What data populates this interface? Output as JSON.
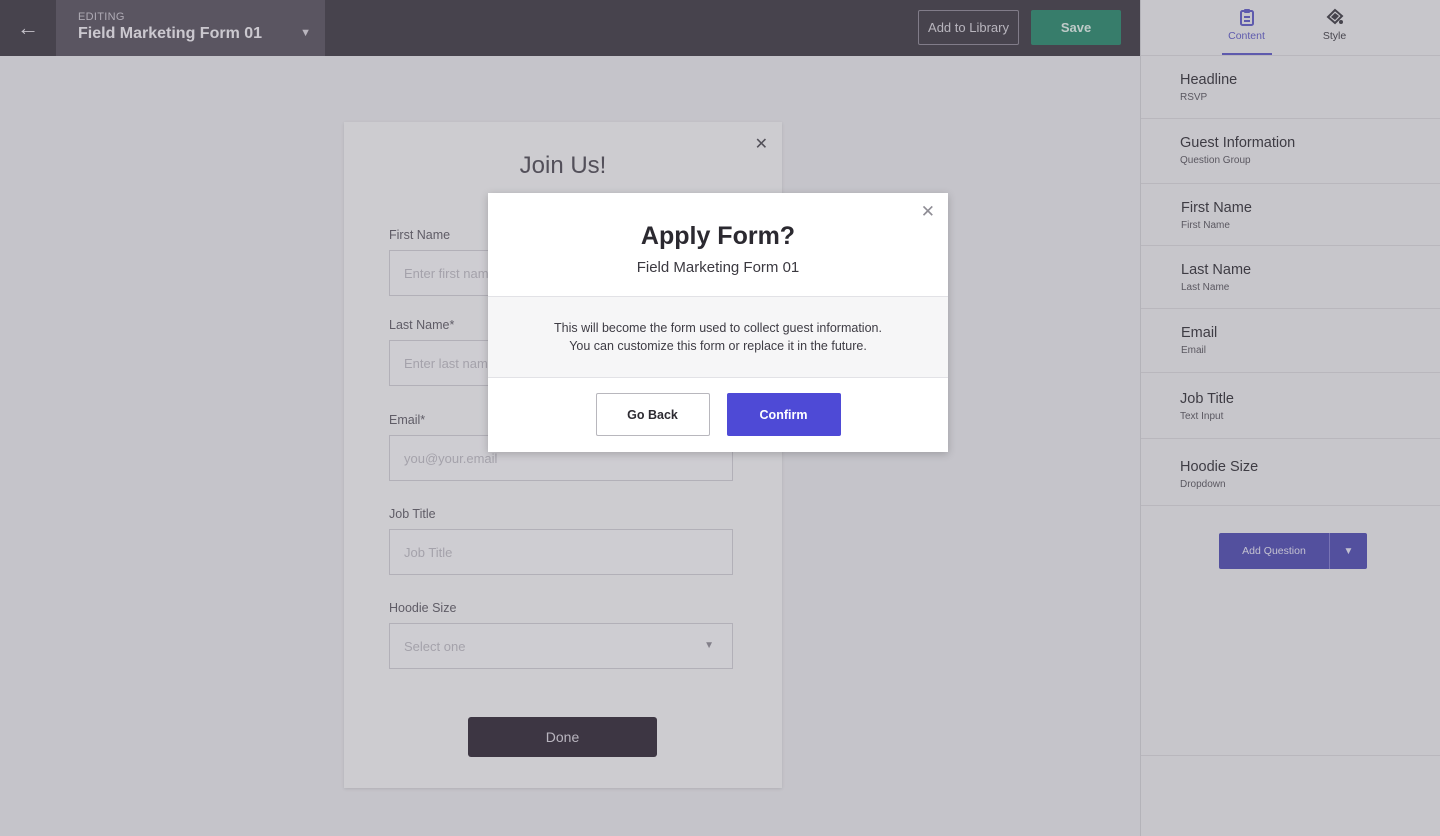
{
  "topbar": {
    "back_icon": "arrow-left-icon",
    "editing_label": "EDITING",
    "form_name": "Field Marketing Form 01",
    "add_to_library": "Add to Library",
    "save": "Save",
    "save_color": "#25876a"
  },
  "panel": {
    "tabs": [
      {
        "label": "Content",
        "icon": "clipboard-icon",
        "active": true
      },
      {
        "label": "Style",
        "icon": "paint-bucket-icon",
        "active": false
      }
    ],
    "questions": [
      {
        "title": "Headline",
        "sub": "RSVP"
      },
      {
        "title": "Guest Information",
        "sub": "Question Group"
      },
      {
        "title": "First Name",
        "sub": "First Name"
      },
      {
        "title": "Last Name",
        "sub": "Last Name"
      },
      {
        "title": "Email",
        "sub": "Email"
      },
      {
        "title": "Job Title",
        "sub": "Text Input"
      },
      {
        "title": "Hoodie Size",
        "sub": "Dropdown"
      }
    ],
    "add_question": "Add Question",
    "accent": "#4b48b0"
  },
  "form_preview": {
    "title": "Join Us!",
    "fields": [
      {
        "label": "First Name",
        "placeholder": "Enter first name"
      },
      {
        "label": "Last Name*",
        "placeholder": "Enter last name"
      },
      {
        "label": "Email*",
        "placeholder": "you@your.email"
      },
      {
        "label": "Job Title",
        "placeholder": "Job Title"
      },
      {
        "label": "Hoodie Size",
        "placeholder": "Select one"
      }
    ],
    "done": "Done"
  },
  "modal": {
    "title": "Apply Form?",
    "subtitle": "Field Marketing Form 01",
    "body_line1": "This will become the form used to collect guest information.",
    "body_line2": "You can customize this form or replace it in the future.",
    "go_back": "Go Back",
    "confirm": "Confirm",
    "confirm_color": "#4e4ad6"
  }
}
